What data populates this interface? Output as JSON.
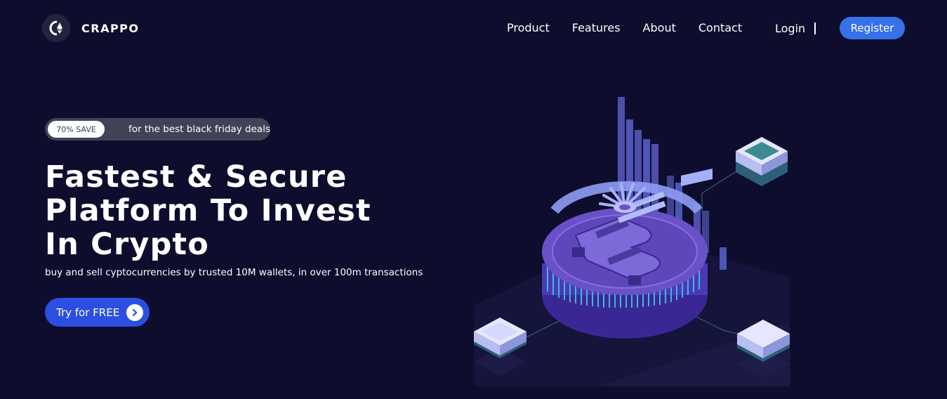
{
  "brand": {
    "name": "CRAPPO",
    "logo_icon": "ethereum-icon"
  },
  "nav": {
    "links": [
      "Product",
      "Features",
      "About",
      "Contact"
    ],
    "login_label": "Login",
    "register_label": "Register"
  },
  "hero": {
    "badge": {
      "pill": "70% SAVE",
      "text": "for the best black friday deals"
    },
    "headline": "Fastest & Secure Platform To Invest In Crypto",
    "subline": "buy and sell cyptocurrencies by trusted 10M wallets, in over 100m transactions",
    "cta": {
      "label": "Try for FREE",
      "icon": "chevron-right-icon"
    },
    "illustration": "bitcoin-coin-network-illustration"
  },
  "colors": {
    "background": "#0f0d2e",
    "accent_blue": "#3671e9",
    "cta_blue": "#2b4fe0",
    "coin_purple": "#6a50c9"
  }
}
